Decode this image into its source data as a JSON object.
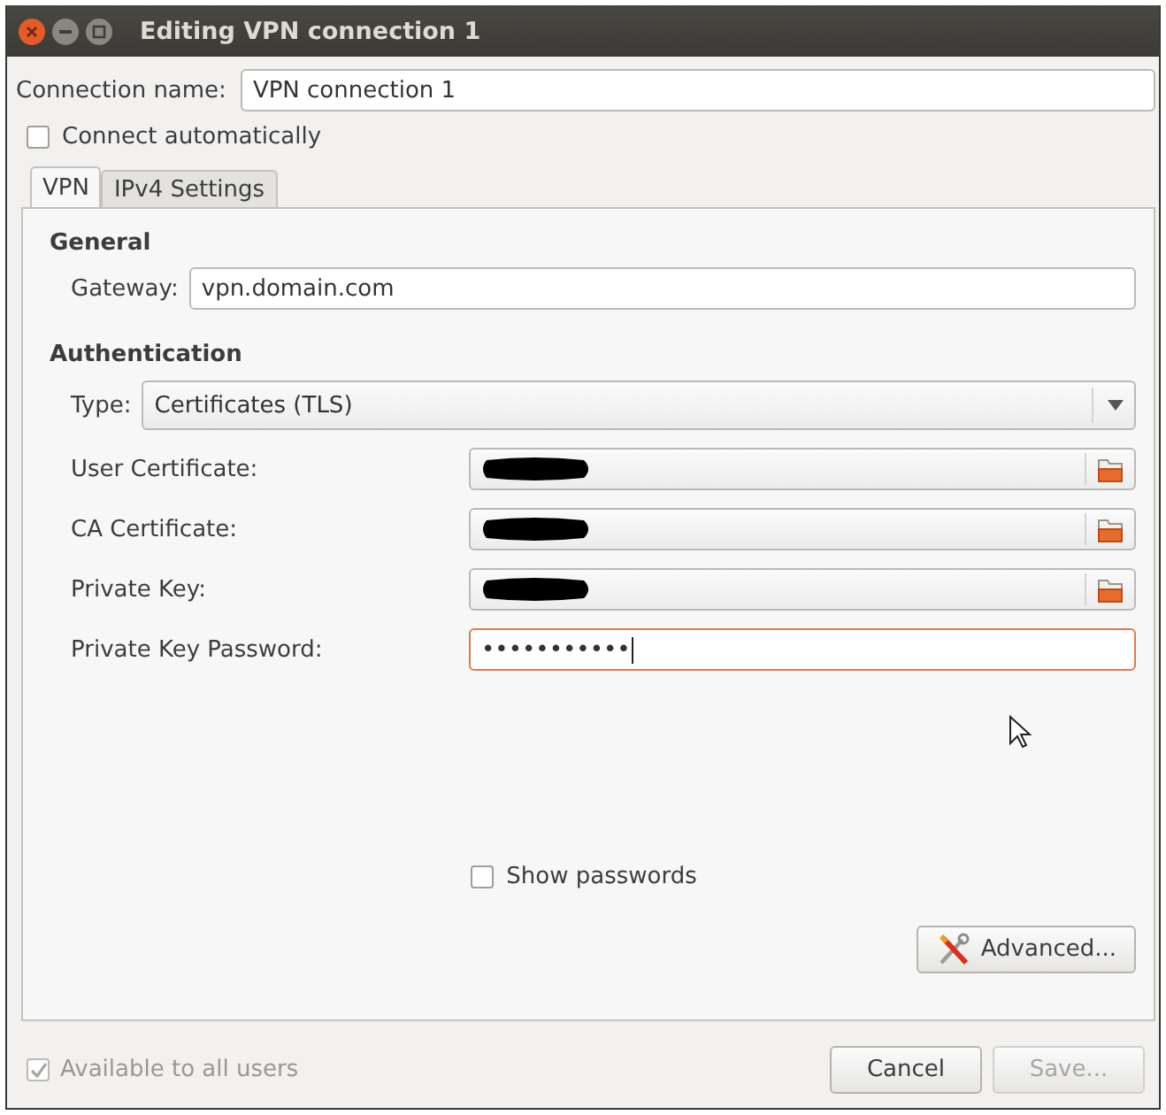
{
  "window": {
    "title": "Editing VPN connection 1"
  },
  "connection_name": {
    "label": "Connection name:",
    "value": "VPN connection 1"
  },
  "connect_automatically": {
    "label": "Connect automatically",
    "checked": false
  },
  "tabs": [
    {
      "label": "VPN",
      "selected": true
    },
    {
      "label": "IPv4 Settings",
      "selected": false
    }
  ],
  "general": {
    "heading": "General",
    "gateway": {
      "label": "Gateway:",
      "value": "vpn.domain.com"
    }
  },
  "authentication": {
    "heading": "Authentication",
    "type": {
      "label": "Type:",
      "value": "Certificates (TLS)"
    },
    "fields": [
      {
        "kind": "file",
        "label": "User Certificate:",
        "redacted": true
      },
      {
        "kind": "file",
        "label": "CA Certificate:",
        "redacted": true
      },
      {
        "kind": "file",
        "label": "Private Key:",
        "redacted": true
      },
      {
        "kind": "password",
        "label": "Private Key Password:",
        "value": "•••••••••••",
        "focused": true
      }
    ]
  },
  "show_passwords": {
    "label": "Show passwords",
    "checked": false
  },
  "advanced_button": {
    "label": "Advanced..."
  },
  "available_to_all_users": {
    "label": "Available to all users",
    "checked": true,
    "disabled": true
  },
  "buttons": [
    {
      "label": "Cancel",
      "disabled": false
    },
    {
      "label": "Save...",
      "disabled": true
    }
  ]
}
